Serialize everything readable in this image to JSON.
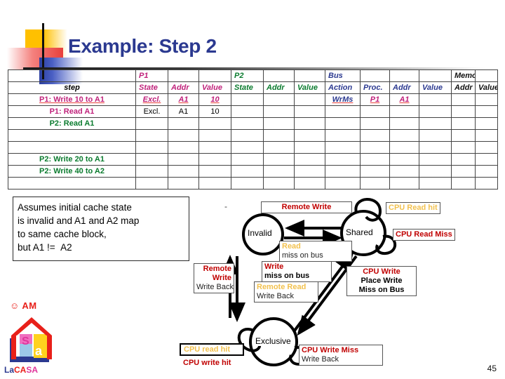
{
  "slide": {
    "title": "Example: Step 2",
    "page_number": "45",
    "title_color": "#2B3990"
  },
  "table": {
    "group_headers": [
      "",
      "P1",
      "",
      "",
      "P2",
      "",
      "",
      "Bus",
      "",
      "",
      "",
      "Memory",
      ""
    ],
    "column_headers": [
      "step",
      "State",
      "Addr",
      "Value",
      "State",
      "Addr",
      "Value",
      "Action",
      "Proc.",
      "Addr",
      "Value",
      "Addr",
      "Value"
    ],
    "rows": [
      {
        "step": "P1: Write 10 to A1",
        "step_color": "p1",
        "highlight": true,
        "cells": [
          "Excl.",
          "A1",
          "10",
          "",
          "",
          "",
          "WrMs",
          "P1",
          "A1",
          "",
          "",
          ""
        ],
        "cell_colors": [
          "p1",
          "p1",
          "p1",
          "",
          "",
          "",
          "bus",
          "p1",
          "p1",
          "",
          "",
          ""
        ]
      },
      {
        "step": "P1: Read A1",
        "step_color": "p1",
        "highlight": false,
        "cells": [
          "Excl.",
          "A1",
          "10",
          "",
          "",
          "",
          "",
          "",
          "",
          "",
          "",
          ""
        ],
        "cell_colors": [
          "blk",
          "blk",
          "blk",
          "",
          "",
          "",
          "",
          "",
          "",
          "",
          "",
          ""
        ]
      },
      {
        "step": "P2: Read A1",
        "step_color": "p2",
        "highlight": false,
        "cells": [
          "",
          "",
          "",
          "",
          "",
          "",
          "",
          "",
          "",
          "",
          "",
          ""
        ],
        "cell_colors": [
          "",
          "",
          "",
          "",
          "",
          "",
          "",
          "",
          "",
          "",
          "",
          ""
        ]
      },
      {
        "step": "",
        "step_color": "",
        "highlight": false,
        "cells": [
          "",
          "",
          "",
          "",
          "",
          "",
          "",
          "",
          "",
          "",
          "",
          ""
        ],
        "cell_colors": [
          "",
          "",
          "",
          "",
          "",
          "",
          "",
          "",
          "",
          "",
          "",
          ""
        ]
      },
      {
        "step": "",
        "step_color": "",
        "highlight": false,
        "cells": [
          "",
          "",
          "",
          "",
          "",
          "",
          "",
          "",
          "",
          "",
          "",
          ""
        ],
        "cell_colors": [
          "",
          "",
          "",
          "",
          "",
          "",
          "",
          "",
          "",
          "",
          "",
          ""
        ]
      },
      {
        "step": "P2: Write 20 to A1",
        "step_color": "p2",
        "highlight": false,
        "cells": [
          "",
          "",
          "",
          "",
          "",
          "",
          "",
          "",
          "",
          "",
          "",
          ""
        ],
        "cell_colors": [
          "",
          "",
          "",
          "",
          "",
          "",
          "",
          "",
          "",
          "",
          "",
          ""
        ]
      },
      {
        "step": "P2: Write 40 to A2",
        "step_color": "p2",
        "highlight": false,
        "cells": [
          "",
          "",
          "",
          "",
          "",
          "",
          "",
          "",
          "",
          "",
          "",
          ""
        ],
        "cell_colors": [
          "",
          "",
          "",
          "",
          "",
          "",
          "",
          "",
          "",
          "",
          "",
          ""
        ]
      },
      {
        "step": "",
        "step_color": "",
        "highlight": false,
        "cells": [
          "",
          "",
          "",
          "",
          "",
          "",
          "",
          "",
          "",
          "",
          "",
          ""
        ],
        "cell_colors": [
          "",
          "",
          "",
          "",
          "",
          "",
          "",
          "",
          "",
          "",
          "",
          ""
        ]
      }
    ]
  },
  "assumption": {
    "line1": "Assumes initial cache state",
    "line2": "is invalid and A1 and A2 map",
    "line3": "to same cache block,",
    "line4": "but A1 !=  A2"
  },
  "diagram": {
    "states": [
      "Invalid",
      "Shared",
      "Exclusive"
    ],
    "stray_dash": "-",
    "labels": {
      "remote_write_top": "Remote Write",
      "cpu_read_hit": "CPU Read hit",
      "cpu_read_miss": "CPU Read Miss",
      "read_l1": "Read",
      "read_l2": "miss on bus",
      "write_l1": "Write",
      "write_l2": "miss on bus",
      "remote_write_l1": "Remote",
      "remote_write_l2": "Write",
      "remote_write_l3": "Write Back",
      "remote_read_l1": "Remote Read",
      "remote_read_l2": "Write Back",
      "cpu_write_l1": "CPU Write",
      "cpu_write_l2": "Place Write",
      "cpu_write_l3": "Miss on Bus",
      "cpu_write_miss_l1": "CPU Write Miss",
      "cpu_write_miss_l2": "Write Back",
      "cpu_read_hit_ex": "CPU read hit",
      "cpu_write_hit_ex": "CPU write hit"
    },
    "colors": {
      "red": "#C00000",
      "gold": "#F2C14E",
      "black": "#000000"
    }
  },
  "logo": {
    "cam": "☺ AM",
    "la": "La",
    "ca": "CA",
    "sa": "SA"
  }
}
